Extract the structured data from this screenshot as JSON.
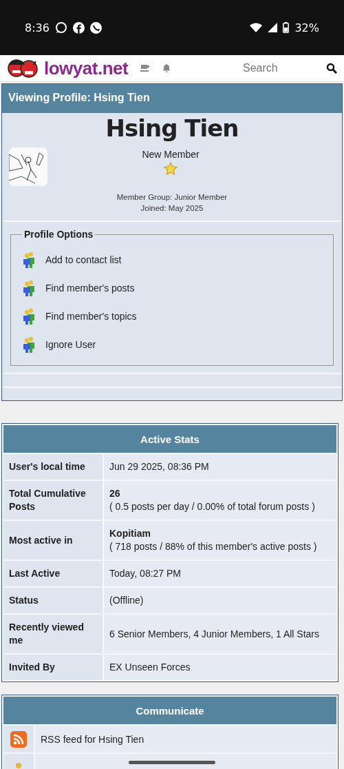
{
  "status_bar": {
    "time": "8:36",
    "battery": "32%"
  },
  "header": {
    "logo_text": "lowyat.net",
    "search_placeholder": "Search"
  },
  "profile": {
    "title": "Viewing Profile: Hsing Tien",
    "name": "Hsing Tien",
    "rank": "New Member",
    "member_group": "Member Group: Junior Member",
    "joined": "Joined: May 2025",
    "options_legend": "Profile Options",
    "options": [
      "Add to contact list",
      "Find member's posts",
      "Find member's topics",
      "Ignore User"
    ]
  },
  "active_stats": {
    "title": "Active Stats",
    "rows": [
      {
        "label": "User's local time",
        "value": "Jun 29 2025, 08:36 PM"
      },
      {
        "label": "Total Cumulative Posts",
        "value": "26",
        "note": "( 0.5 posts per day / 0.00% of total forum posts )"
      },
      {
        "label": "Most active in",
        "value": "Kopitiam",
        "note": "( 718 posts / 88% of this member's active posts )"
      },
      {
        "label": "Last Active",
        "value": "Today, 08:27 PM"
      },
      {
        "label": "Status",
        "value": "(Offline)"
      },
      {
        "label": "Recently viewed me",
        "value": "6 Senior Members, 4 Junior Members, 1 All Stars"
      },
      {
        "label": "Invited By",
        "value": "EX Unseen Forces"
      }
    ]
  },
  "communicate": {
    "title": "Communicate",
    "rows": [
      {
        "kind": "rss",
        "label": "RSS feed for Hsing Tien"
      },
      {
        "kind": "contact"
      }
    ]
  }
}
